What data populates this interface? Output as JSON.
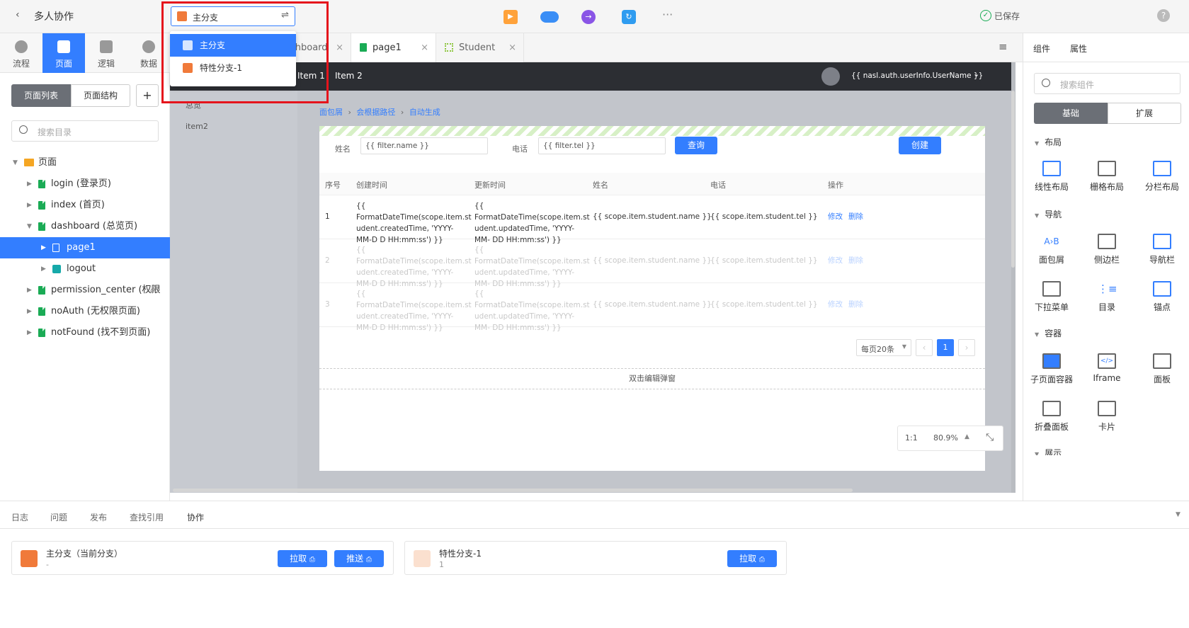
{
  "topbar": {
    "title": "多人协作",
    "branch_selected": "主分支",
    "saved_label": "已保存",
    "more_label": "···",
    "help_label": "?"
  },
  "branch_dropdown": {
    "options": [
      "主分支",
      "特性分支-1"
    ],
    "selected": "主分支"
  },
  "left_rail": {
    "items": [
      {
        "label": "流程",
        "icon": "flow-icon"
      },
      {
        "label": "页面",
        "icon": "page-icon"
      },
      {
        "label": "逻辑",
        "icon": "logic-icon"
      },
      {
        "label": "数据",
        "icon": "data-icon"
      }
    ],
    "active": "页面"
  },
  "sidebar": {
    "seg_list": "页面列表",
    "seg_structure": "页面结构",
    "add_label": "+",
    "search_placeholder": "搜索目录",
    "tree": {
      "root": "页面",
      "items": [
        {
          "label": "login (登录页)"
        },
        {
          "label": "index (首页)"
        },
        {
          "label": "dashboard (总览页)"
        },
        {
          "label": "page1"
        },
        {
          "label": "logout"
        },
        {
          "label": "permission_center (权限"
        },
        {
          "label": "noAuth (无权限页面)"
        },
        {
          "label": "notFound (找不到页面)"
        }
      ]
    }
  },
  "tabs": {
    "items": [
      {
        "label": "shboard"
      },
      {
        "label": "page1"
      },
      {
        "label": "Student"
      }
    ],
    "menu_icon": "≡"
  },
  "canvas": {
    "nav_items": [
      "Item 1",
      "Item 2"
    ],
    "user_template": "{{ nasl.auth.userInfo.UserName }}",
    "side_items": [
      "总览",
      "item2"
    ],
    "breadcrumb": [
      "面包屑",
      "会根据路径",
      "自动生成"
    ],
    "filter": {
      "name_label": "姓名",
      "name_value": "{{ filter.name }}",
      "tel_label": "电话",
      "tel_value": "{{ filter.tel }}",
      "query_label": "查询",
      "create_label": "创建"
    },
    "table": {
      "headers": [
        "序号",
        "创建时间",
        "更新时间",
        "姓名",
        "电话",
        "操作"
      ],
      "rows": [
        {
          "index": "1",
          "created": "{{ FormatDateTime(scope.item.st udent.createdTime, 'YYYY-MM-D D HH:mm:ss') }}",
          "updated": "{{ FormatDateTime(scope.item.st udent.updatedTime, 'YYYY-MM- DD HH:mm:ss') }}",
          "name": "{{ scope.item.student.name }}",
          "tel": "{{ scope.item.student.tel }}",
          "edit": "修改",
          "delete": "删除"
        },
        {
          "index": "2",
          "created": "{{ FormatDateTime(scope.item.st udent.createdTime, 'YYYY-MM-D D HH:mm:ss') }}",
          "updated": "{{ FormatDateTime(scope.item.st udent.updatedTime, 'YYYY-MM- DD HH:mm:ss') }}",
          "name": "{{ scope.item.student.name }}",
          "tel": "{{ scope.item.student.tel }}",
          "edit": "修改",
          "delete": "删除"
        },
        {
          "index": "3",
          "created": "{{ FormatDateTime(scope.item.st udent.createdTime, 'YYYY-MM-D D HH:mm:ss') }}",
          "updated": "{{ FormatDateTime(scope.item.st udent.updatedTime, 'YYYY-MM- DD HH:mm:ss') }}",
          "name": "{{ scope.item.student.name }}",
          "tel": "{{ scope.item.student.tel }}",
          "edit": "修改",
          "delete": "删除"
        }
      ]
    },
    "pagination": {
      "per_page": "每页20条",
      "current": "1"
    },
    "modal_hint": "双击编辑弹窗",
    "zoom": {
      "ratio_label": "1:1",
      "level": "80.9%"
    }
  },
  "right_panel": {
    "tabs": [
      "组件",
      "属性"
    ],
    "search_placeholder": "搜索组件",
    "seg_basic": "基础",
    "seg_ext": "扩展",
    "sections": [
      {
        "title": "布局",
        "items": [
          "线性布局",
          "栅格布局",
          "分栏布局"
        ]
      },
      {
        "title": "导航",
        "items": [
          "面包屑",
          "侧边栏",
          "导航栏",
          "下拉菜单",
          "目录",
          "锚点"
        ]
      },
      {
        "title": "容器",
        "items": [
          "子页面容器",
          "Iframe",
          "面板",
          "折叠面板",
          "卡片"
        ]
      },
      {
        "title": "展示",
        "items": []
      }
    ]
  },
  "bottom": {
    "tabs": [
      "日志",
      "问题",
      "发布",
      "查找引用",
      "协作"
    ],
    "active_tab": "协作",
    "branches": [
      {
        "name": "主分支（当前分支）",
        "sub": "-",
        "pull": "拉取",
        "push": "推送"
      },
      {
        "name": "特性分支-1",
        "sub": "1",
        "pull": "拉取"
      }
    ]
  },
  "colors": {
    "accent": "#337eff",
    "highlight": "#e5141c",
    "branch_orange": "#f07a3a",
    "saved_green": "#1aab55"
  }
}
